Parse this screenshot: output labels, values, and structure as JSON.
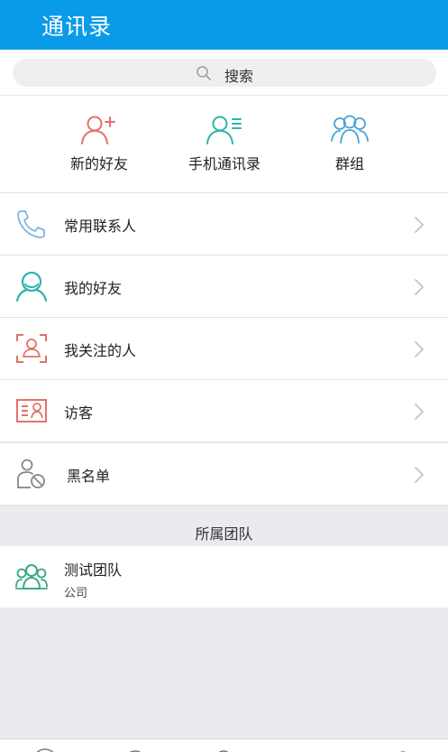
{
  "header": {
    "title": "通讯录"
  },
  "search": {
    "label": "搜索"
  },
  "quick_actions": [
    {
      "label": "新的好友",
      "icon": "add-user-icon"
    },
    {
      "label": "手机通讯录",
      "icon": "phone-contacts-icon"
    },
    {
      "label": "群组",
      "icon": "group-icon"
    }
  ],
  "list": [
    {
      "label": "常用联系人",
      "icon": "phone-icon"
    },
    {
      "label": "我的好友",
      "icon": "friend-icon"
    },
    {
      "label": "我关注的人",
      "icon": "followed-person-icon"
    },
    {
      "label": "访客",
      "icon": "visitor-card-icon"
    },
    {
      "label": "黑名单",
      "icon": "blocked-user-icon"
    }
  ],
  "teams": {
    "section_title": "所属团队",
    "items": [
      {
        "name": "测试团队",
        "type": "公司",
        "icon": "team-icon"
      }
    ]
  },
  "colors": {
    "header": "#0a9be8",
    "red_icon": "#e4706c",
    "teal_icon": "#2eb5a8",
    "blue_icon": "#4aa3d8",
    "green_icon": "#3aa886"
  }
}
